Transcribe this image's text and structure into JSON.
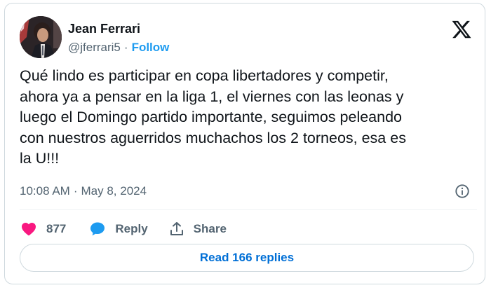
{
  "author": {
    "name": "Jean Ferrari",
    "handle": "@jferrari5",
    "separator": "·",
    "follow_label": "Follow"
  },
  "tweet": {
    "text": "Qué lindo es participar en copa libertadores y competir,\nahora ya a pensar en la liga 1, el viernes con las leonas y\nluego el Domingo partido importante, seguimos peleando\ncon nuestros aguerridos muchachos los 2 torneos, esa es\nla U!!!",
    "time": "10:08 AM",
    "separator": "·",
    "date": "May 8, 2024"
  },
  "actions": {
    "like_count": "877",
    "reply_label": "Reply",
    "share_label": "Share"
  },
  "replies_button": {
    "label": "Read 166 replies"
  },
  "icons": {
    "brand": "x-logo",
    "info": "info-icon",
    "like": "heart-icon",
    "reply": "speech-bubble-icon",
    "share": "share-icon"
  },
  "colors": {
    "text": "#0f1419",
    "muted": "#536471",
    "link": "#1d9bf0",
    "replies_link": "#006fd6",
    "like": "#f91880",
    "reply": "#1d9bf0",
    "border": "#cfd9de"
  }
}
